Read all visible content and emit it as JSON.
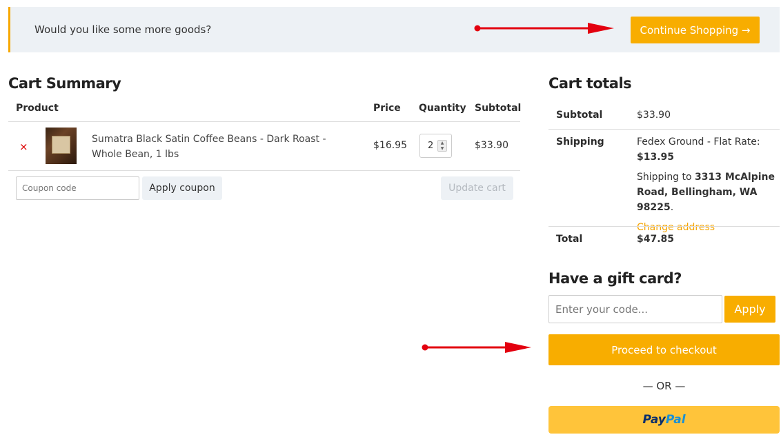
{
  "notice": {
    "text": "Would you like some more goods?",
    "button_label": "Continue Shopping →"
  },
  "cart": {
    "title": "Cart Summary",
    "columns": [
      "Product",
      "Price",
      "Quantity",
      "Subtotal"
    ],
    "items": [
      {
        "name": "Sumatra Black Satin Coffee Beans - Dark Roast - Whole Bean, 1 lbs",
        "price": "$16.95",
        "quantity": "2",
        "subtotal": "$33.90",
        "remove_glyph": "×"
      }
    ],
    "coupon_placeholder": "Coupon code",
    "apply_coupon_label": "Apply coupon",
    "update_cart_label": "Update cart"
  },
  "totals": {
    "title": "Cart totals",
    "subtotal_label": "Subtotal",
    "subtotal_value": "$33.90",
    "shipping_label": "Shipping",
    "shipping_method": "Fedex Ground - Flat Rate:",
    "shipping_cost": "$13.95",
    "shipping_to_prefix": "Shipping to",
    "shipping_address": "3313 McAlpine Road, Bellingham, WA 98225",
    "change_address_label": "Change address",
    "total_label": "Total",
    "total_value": "$47.85"
  },
  "gift_card": {
    "title": "Have a gift card?",
    "placeholder": "Enter your code...",
    "apply_label": "Apply"
  },
  "checkout": {
    "proceed_label": "Proceed to checkout",
    "or_text": "— OR —",
    "paypal_part1": "Pay",
    "paypal_part2": "Pal"
  },
  "colors": {
    "accent": "#f8ad00",
    "annotation_arrow": "#e3000f",
    "paypal_button": "#ffc43a",
    "notice_bg": "#edf1f5"
  },
  "icons": {
    "remove": "remove-icon",
    "arrow": "red-arrow-annotation",
    "spinner": "quantity-spinner-icon",
    "product_image": "coffee-bag-thumbnail"
  }
}
